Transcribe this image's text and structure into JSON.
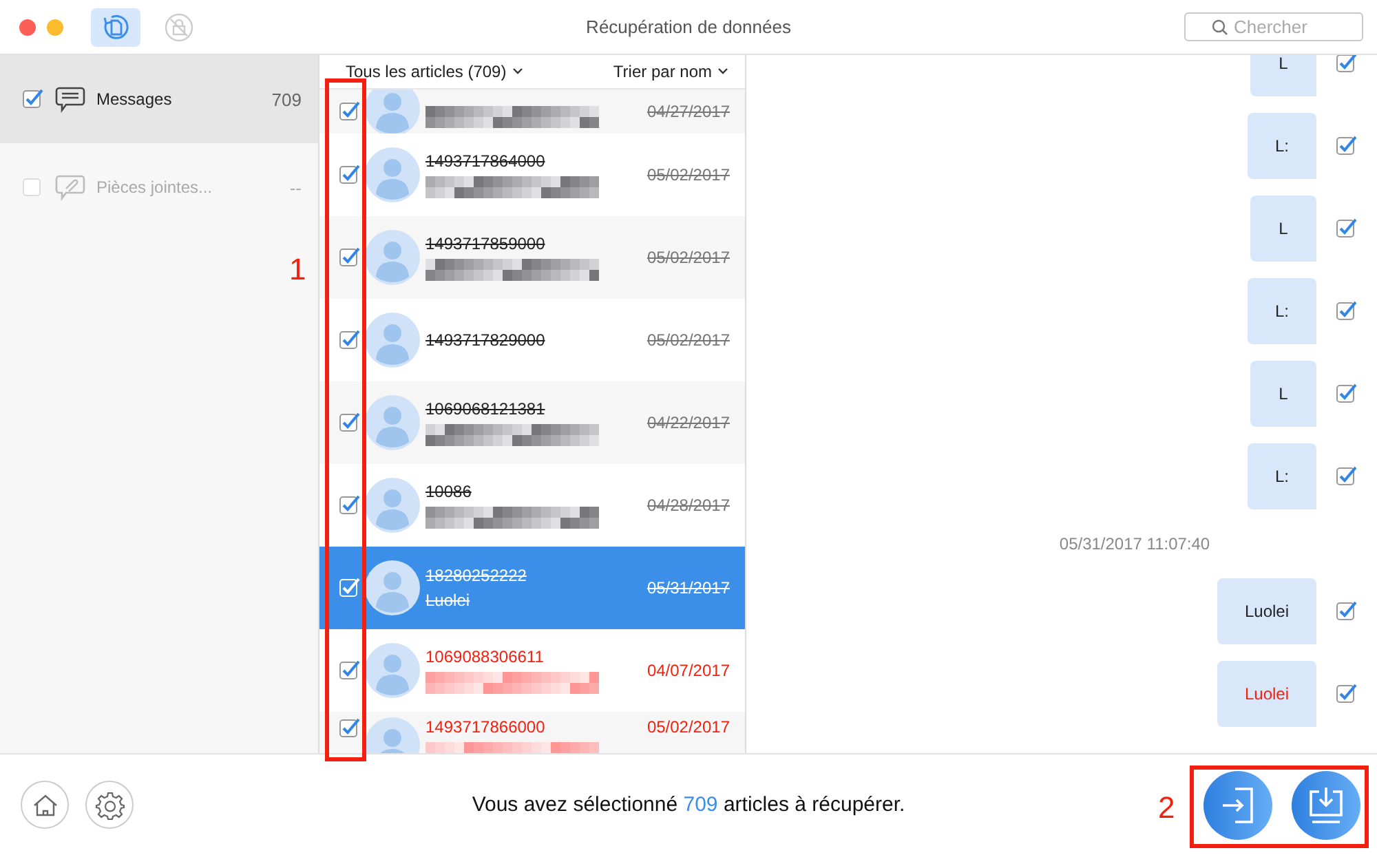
{
  "window": {
    "title": "Récupération de données"
  },
  "toolbar": [
    {
      "kind": "recover",
      "selected": true
    },
    {
      "kind": "lock",
      "selected": false
    }
  ],
  "search": {
    "placeholder": "Chercher"
  },
  "sidebar": {
    "items": [
      {
        "label": "Messages",
        "count": "709",
        "checked": true,
        "selected": true,
        "disabled": false,
        "kind": "messages"
      },
      {
        "label": "Pièces jointes...",
        "count": "--",
        "checked": false,
        "selected": false,
        "disabled": true,
        "kind": "attachments"
      }
    ]
  },
  "list": {
    "filter": "Tous les articles (709)",
    "sort": "Trier par nom",
    "rows": [
      {
        "kind": "blurred",
        "date": "04/27/2017",
        "checked": true,
        "selected": false,
        "strikethrough": true,
        "flagged": false
      },
      {
        "number": "1493717864000",
        "kind": "blurred",
        "date": "05/02/2017",
        "checked": true,
        "selected": false,
        "strikethrough": true,
        "flagged": false
      },
      {
        "number": "1493717859000",
        "kind": "blurred",
        "date": "05/02/2017",
        "checked": true,
        "selected": false,
        "strikethrough": true,
        "flagged": false
      },
      {
        "number": "1493717829000",
        "kind": "none",
        "date": "05/02/2017",
        "checked": true,
        "selected": false,
        "strikethrough": true,
        "flagged": false
      },
      {
        "number": "1069068121381",
        "kind": "blurred",
        "date": "04/22/2017",
        "checked": true,
        "selected": false,
        "strikethrough": true,
        "flagged": false
      },
      {
        "number": "10086",
        "kind": "blurred",
        "date": "04/28/2017",
        "checked": true,
        "selected": false,
        "strikethrough": true,
        "flagged": false
      },
      {
        "number": "18280252222",
        "kind": "text",
        "preview": "Luolei",
        "date": "05/31/2017",
        "checked": true,
        "selected": true,
        "strikethrough": true,
        "flagged": false
      },
      {
        "number": "1069088306611",
        "kind": "blurred",
        "date": "04/07/2017",
        "checked": true,
        "selected": false,
        "strikethrough": false,
        "flagged": true
      },
      {
        "number": "1493717866000",
        "kind": "blurred",
        "date": "05/02/2017",
        "checked": true,
        "selected": false,
        "strikethrough": false,
        "flagged": true
      }
    ]
  },
  "chat": [
    {
      "kind": "message",
      "text": "L",
      "checked": true,
      "flagged": false
    },
    {
      "kind": "message",
      "text": "L:",
      "checked": true,
      "flagged": false
    },
    {
      "kind": "message",
      "text": "L",
      "checked": true,
      "flagged": false
    },
    {
      "kind": "message",
      "text": "L:",
      "checked": true,
      "flagged": false
    },
    {
      "kind": "message",
      "text": "L",
      "checked": true,
      "flagged": false
    },
    {
      "kind": "message",
      "text": "L:",
      "checked": true,
      "flagged": false
    },
    {
      "kind": "timestamp",
      "text": "05/31/2017 11:07:40"
    },
    {
      "kind": "message",
      "text": "Luolei",
      "checked": true,
      "flagged": false
    },
    {
      "kind": "message",
      "text": "Luolei",
      "checked": true,
      "flagged": true
    }
  ],
  "footer": {
    "before": "Vous avez sélectionné",
    "count": "709",
    "after": "articles à récupérer."
  },
  "annotations": [
    {
      "label": "1",
      "kind": "checkbox-column"
    },
    {
      "label": "2",
      "kind": "buttons"
    }
  ]
}
